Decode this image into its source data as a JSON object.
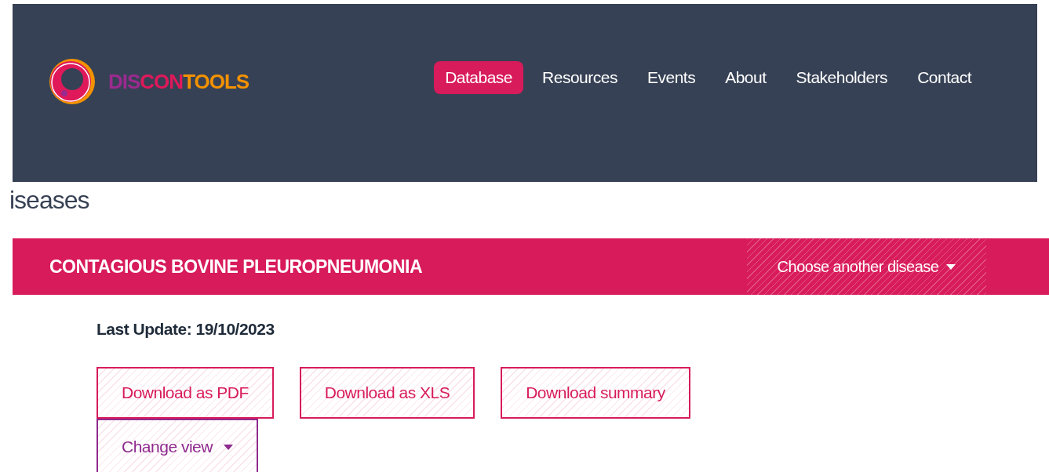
{
  "header": {
    "logo": {
      "parts": [
        {
          "text": "DIS",
          "color": "#9b2a8f"
        },
        {
          "text": "CON",
          "color": "#e0195a"
        },
        {
          "text": "TOOLS",
          "color": "#f39200"
        }
      ]
    },
    "nav": [
      {
        "label": "Database",
        "selected": true
      },
      {
        "label": "Resources",
        "selected": false
      },
      {
        "label": "Events",
        "selected": false
      },
      {
        "label": "About",
        "selected": false
      },
      {
        "label": "Stakeholders",
        "selected": false
      },
      {
        "label": "Contact",
        "selected": false
      }
    ]
  },
  "page_title": "iseases",
  "disease_bar": {
    "title": "CONTAGIOUS BOVINE PLEUROPNEUMONIA",
    "dropdown": "Choose another disease"
  },
  "last_update": "Last Update: 19/10/2023",
  "buttons": [
    {
      "label": "Download as PDF",
      "kind": "download"
    },
    {
      "label": "Download as XLS",
      "kind": "download"
    },
    {
      "label": "Download summary",
      "kind": "download"
    },
    {
      "label": "Change view",
      "kind": "dropdown"
    }
  ]
}
